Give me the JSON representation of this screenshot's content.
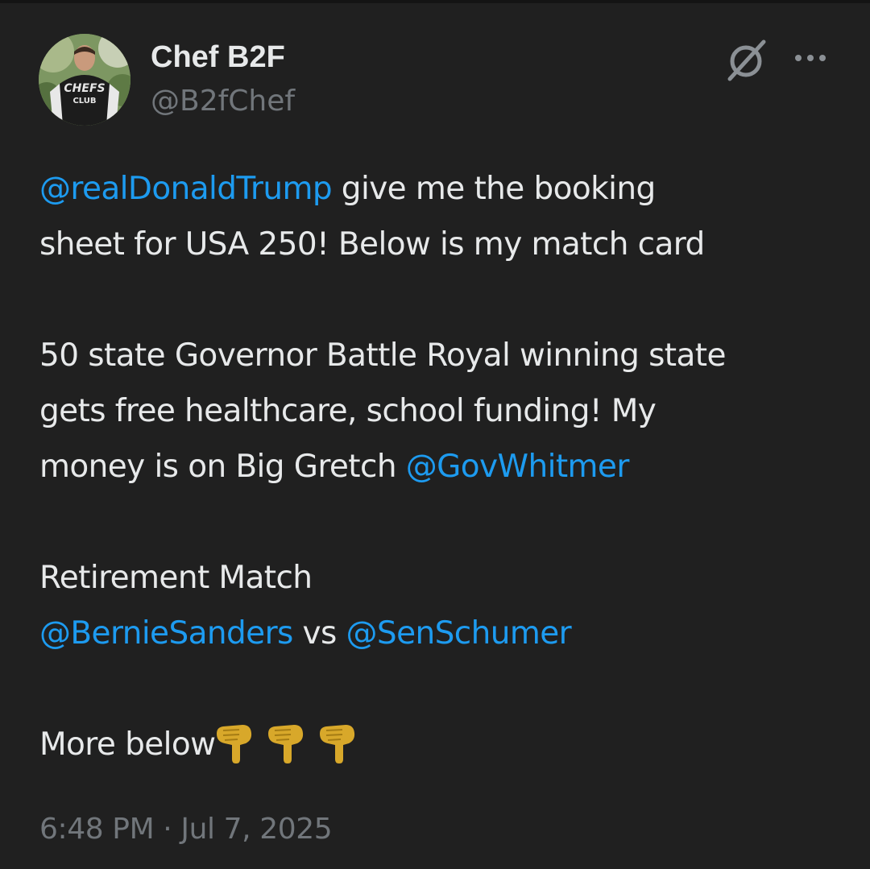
{
  "author": {
    "name": "Chef B2F",
    "handle": "@B2fChef",
    "avatar_shirt_text_top": "CHEFS",
    "avatar_shirt_text_bottom": "CLUB"
  },
  "header_icons": {
    "grok": "grok-icon",
    "more": "more-options-icon"
  },
  "tweet": {
    "l1_mention": "@realDonaldTrump",
    "l1_text": " give me the booking",
    "l2_text": "sheet for USA 250! Below is my match card",
    "l3_text": "50 state Governor Battle Royal winning state",
    "l4_text": "gets free healthcare, school funding! My",
    "l5_text": "money is on Big Gretch ",
    "l5_mention": "@GovWhitmer",
    "l6_text": "Retirement Match",
    "l7_mention_1": "@BernieSanders",
    "l7_text": " vs ",
    "l7_mention_2": "@SenSchumer",
    "l8_text": "More below",
    "emojis": [
      "backhand-index-pointing-down",
      "backhand-index-pointing-down",
      "backhand-index-pointing-down"
    ]
  },
  "timestamp": "6:48 PM · Jul 7, 2025",
  "colors": {
    "background": "#202020",
    "text": "#e7e9ea",
    "secondary": "#71767b",
    "link": "#1d9bf0",
    "emoji": "#d8a82a"
  }
}
